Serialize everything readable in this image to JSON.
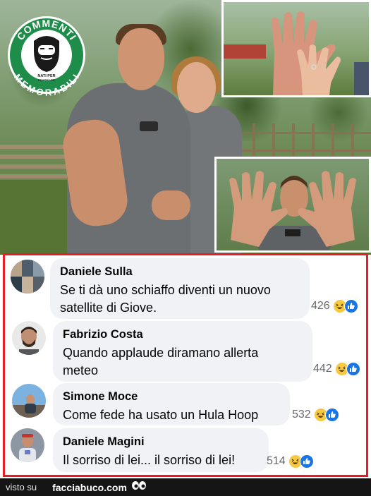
{
  "logo": {
    "top_text": "COMMENTI",
    "bottom_text": "MEMORABILI",
    "tagline_1": "NATI PER",
    "tagline_2": "IGNORARE",
    "colors": {
      "ring": "#1e8d4a",
      "inner": "#ffffff",
      "face": "#1a1a1a"
    }
  },
  "comments": [
    {
      "name": "Daniele Sulla",
      "lines": [
        "Se ti dà uno schiaffo diventi un nuovo",
        "satellite di Giove."
      ],
      "count": "426"
    },
    {
      "name": "Fabrizio Costa",
      "lines": [
        "Quando applaude diramano allerta",
        "meteo"
      ],
      "count": "442"
    },
    {
      "name": "Simone Moce",
      "lines": [
        "Come fede ha usato un Hula Hoop"
      ],
      "count": "532"
    },
    {
      "name": "Daniele Magini",
      "lines": [
        "Il sorriso di lei... il sorriso di lei!"
      ],
      "count": "514"
    }
  ],
  "reactions": {
    "icons": [
      "haha-emoji",
      "like-icon"
    ],
    "colors": {
      "haha": "#f7c940",
      "like": "#1b74e4"
    }
  },
  "footer": {
    "prefix": "visto su",
    "site": "facciabuco.com"
  },
  "colors": {
    "panel_border": "#e61d25",
    "bubble": "#f0f2f5",
    "footer_bg": "#151515"
  }
}
